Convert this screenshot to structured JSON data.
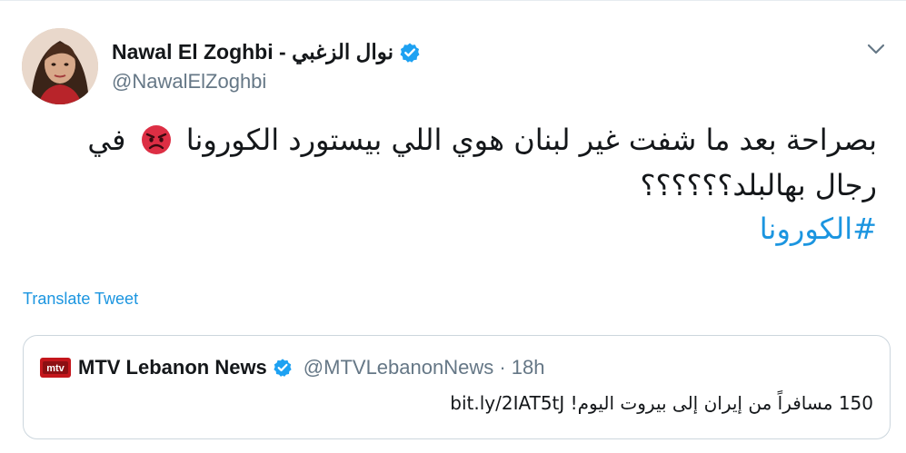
{
  "tweet": {
    "display_name": "Nawal El Zoghbi - نوال الزغبي",
    "handle": "@NawalElZoghbi",
    "avatar_icon": "avatar-photo",
    "body_line_before_emoji": "بصراحة بعد ما شفت غير لبنان هوي اللي بيستورد الكورونا",
    "body_emoji": "angry-face-emoji",
    "body_line_after_emoji": "في رجال بهالبلد؟؟؟؟؟؟",
    "hashtag": "#الكورونا",
    "translate_label": "Translate Tweet",
    "verified_icon": "verified-badge-icon",
    "caret_icon": "chevron-down-icon"
  },
  "quote": {
    "logo_icon": "mtv-logo-icon",
    "name": "MTV Lebanon News",
    "meta": "@MTVLebanonNews · 18h",
    "text": "150 مسافراً من إيران إلى بيروت اليوم! bit.ly/2IAT5tJ"
  },
  "colors": {
    "link": "#1b95e0",
    "text": "#14171a",
    "secondary": "#657786",
    "border": "#ccd6dd",
    "verified": "#1da1f2"
  }
}
